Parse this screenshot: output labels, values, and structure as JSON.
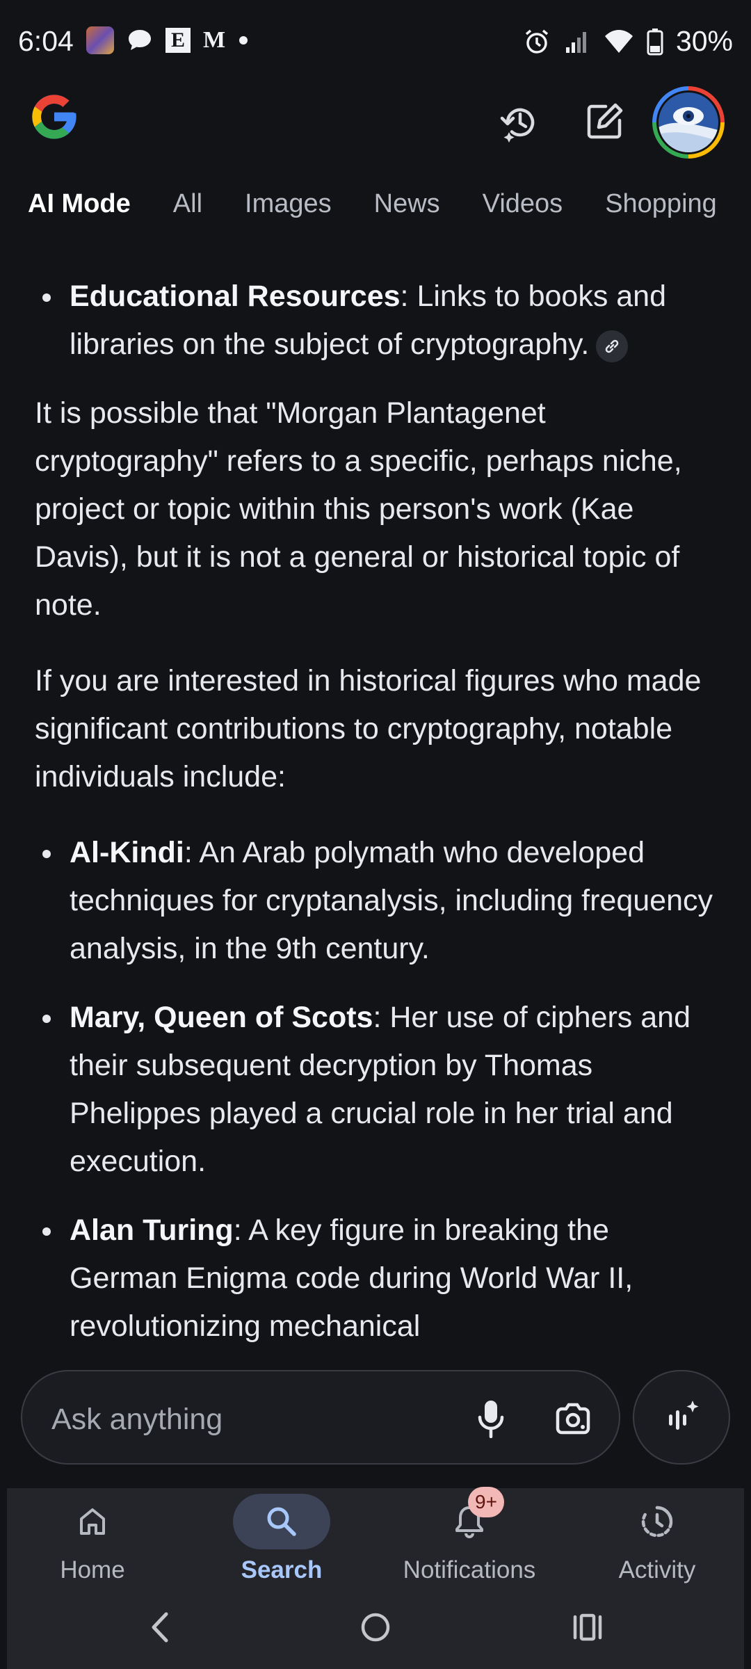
{
  "status_bar": {
    "time": "6:04",
    "battery": "30%"
  },
  "tabs": [
    {
      "label": "AI Mode",
      "active": true
    },
    {
      "label": "All"
    },
    {
      "label": "Images"
    },
    {
      "label": "News"
    },
    {
      "label": "Videos"
    },
    {
      "label": "Shopping"
    }
  ],
  "content": {
    "bullet_top": {
      "bold": "Educational Resources",
      "text": ": Links to books and libraries on the subject of cryptography."
    },
    "paragraph_1": "It is possible that \"Morgan Plantagenet cryptography\" refers to a specific, perhaps niche, project or topic within this person's work (Kae Davis), but it is not a general or historical topic of note.",
    "paragraph_2": "If you are interested in historical figures who made significant contributions to cryptography, notable individuals include:",
    "figures": [
      {
        "bold": "Al-Kindi",
        "text": ": An Arab polymath who developed techniques for cryptanalysis, including frequency analysis, in the 9th century."
      },
      {
        "bold": "Mary, Queen of Scots",
        "text": ": Her use of ciphers and their subsequent decryption by Thomas Phelippes played a crucial role in her trial and execution."
      },
      {
        "bold": "Alan Turing",
        "text": ": A key figure in breaking the German Enigma code during World War II, revolutionizing mechanical"
      }
    ]
  },
  "ask_bar": {
    "placeholder": "Ask anything"
  },
  "bottom_nav": [
    {
      "label": "Home",
      "icon": "home-icon"
    },
    {
      "label": "Search",
      "icon": "search-icon",
      "active": true
    },
    {
      "label": "Notifications",
      "icon": "bell-icon",
      "badge": "9+"
    },
    {
      "label": "Activity",
      "icon": "activity-icon"
    }
  ],
  "colors": {
    "background": "#121317",
    "active_tab": "#a8c7fa",
    "badge": "#f2b8b5"
  }
}
